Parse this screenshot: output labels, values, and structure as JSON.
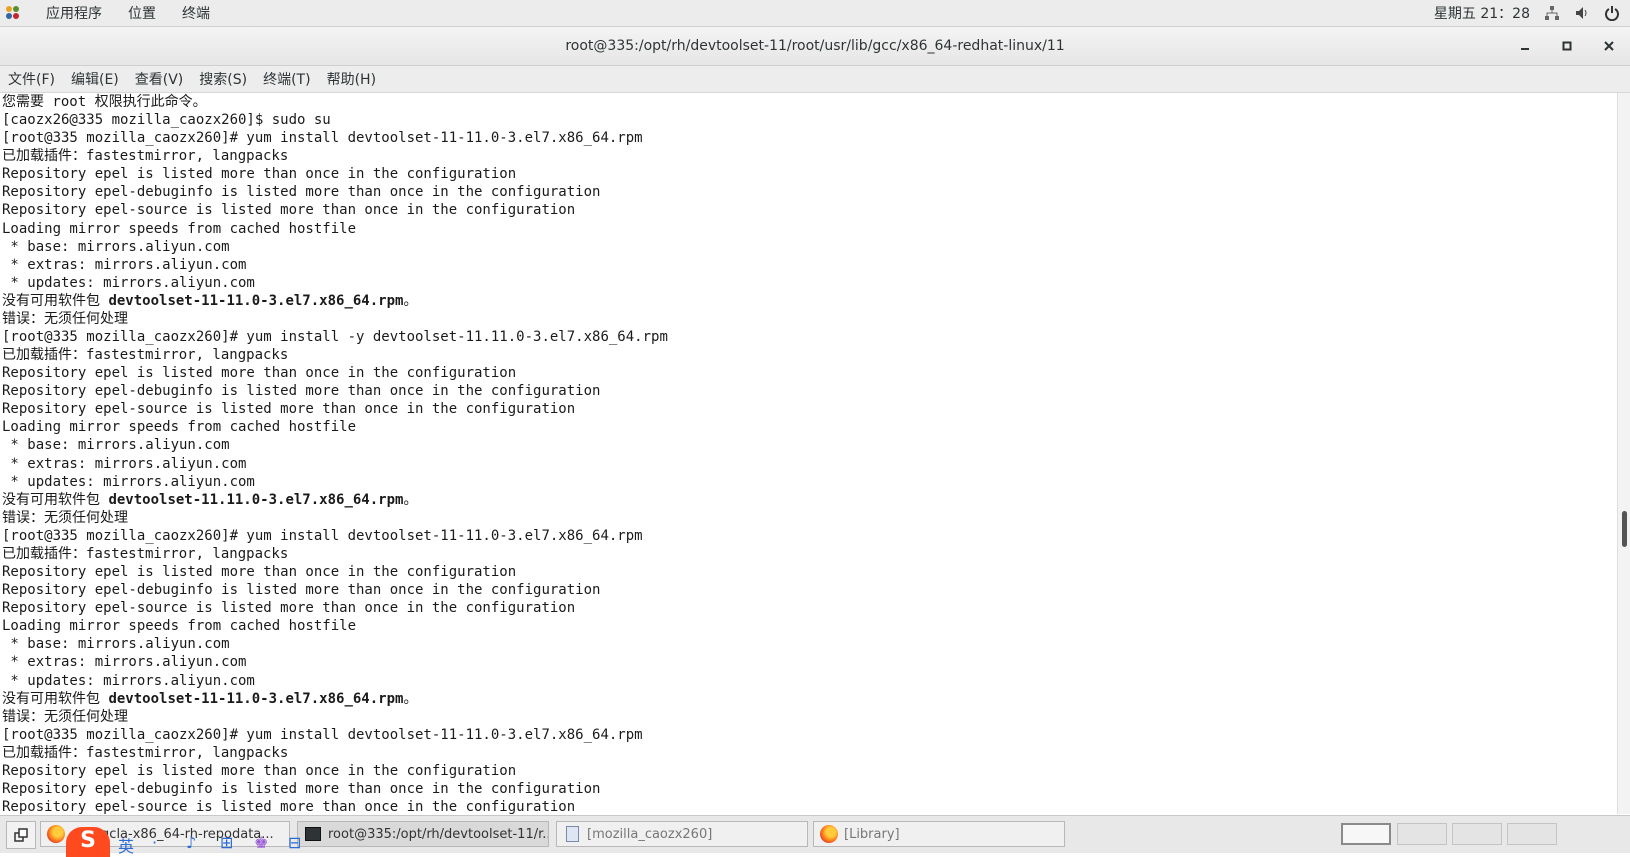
{
  "top_panel": {
    "menus": [
      "应用程序",
      "位置",
      "终端"
    ],
    "clock": "星期五 21：28",
    "icons": [
      "network-icon",
      "volume-icon",
      "power-icon"
    ]
  },
  "window": {
    "title": "root@335:/opt/rh/devtoolset-11/root/usr/lib/gcc/x86_64-redhat-linux/11",
    "controls": [
      "minimize-icon",
      "maximize-icon",
      "close-icon"
    ]
  },
  "menubar": {
    "items": [
      "文件(F)",
      "编辑(E)",
      "查看(V)",
      "搜索(S)",
      "终端(T)",
      "帮助(H)"
    ]
  },
  "terminal": {
    "lines": [
      {
        "text": "您需要 root 权限执行此命令。"
      },
      {
        "text": "[caozx26@335 mozilla_caozx260]$ sudo su"
      },
      {
        "text": "[root@335 mozilla_caozx260]# yum install devtoolset-11-11.0-3.el7.x86_64.rpm"
      },
      {
        "text": "已加载插件：fastestmirror, langpacks"
      },
      {
        "text": "Repository epel is listed more than once in the configuration"
      },
      {
        "text": "Repository epel-debuginfo is listed more than once in the configuration"
      },
      {
        "text": "Repository epel-source is listed more than once in the configuration"
      },
      {
        "text": "Loading mirror speeds from cached hostfile"
      },
      {
        "text": " * base: mirrors.aliyun.com"
      },
      {
        "text": " * extras: mirrors.aliyun.com"
      },
      {
        "text": " * updates: mirrors.aliyun.com"
      },
      {
        "prefix": "没有可用软件包 ",
        "bold": "devtoolset-11-11.0-3.el7.x86_64.rpm",
        "suffix": "。"
      },
      {
        "text": "错误：无须任何处理"
      },
      {
        "text": "[root@335 mozilla_caozx260]# yum install -y devtoolset-11.11.0-3.el7.x86_64.rpm"
      },
      {
        "text": "已加载插件：fastestmirror, langpacks"
      },
      {
        "text": "Repository epel is listed more than once in the configuration"
      },
      {
        "text": "Repository epel-debuginfo is listed more than once in the configuration"
      },
      {
        "text": "Repository epel-source is listed more than once in the configuration"
      },
      {
        "text": "Loading mirror speeds from cached hostfile"
      },
      {
        "text": " * base: mirrors.aliyun.com"
      },
      {
        "text": " * extras: mirrors.aliyun.com"
      },
      {
        "text": " * updates: mirrors.aliyun.com"
      },
      {
        "prefix": "没有可用软件包 ",
        "bold": "devtoolset-11.11.0-3.el7.x86_64.rpm",
        "suffix": "。"
      },
      {
        "text": "错误：无须任何处理"
      },
      {
        "text": "[root@335 mozilla_caozx260]# yum install devtoolset-11-11.0-3.el7.x86_64.rpm"
      },
      {
        "text": "已加载插件：fastestmirror, langpacks"
      },
      {
        "text": "Repository epel is listed more than once in the configuration"
      },
      {
        "text": "Repository epel-debuginfo is listed more than once in the configuration"
      },
      {
        "text": "Repository epel-source is listed more than once in the configuration"
      },
      {
        "text": "Loading mirror speeds from cached hostfile"
      },
      {
        "text": " * base: mirrors.aliyun.com"
      },
      {
        "text": " * extras: mirrors.aliyun.com"
      },
      {
        "text": " * updates: mirrors.aliyun.com"
      },
      {
        "prefix": "没有可用软件包 ",
        "bold": "devtoolset-11-11.0-3.el7.x86_64.rpm",
        "suffix": "。"
      },
      {
        "text": "错误：无须任何处理"
      },
      {
        "text": "[root@335 mozilla_caozx260]# yum install devtoolset-11-11.0-3.el7.x86_64.rpm"
      },
      {
        "text": "已加载插件：fastestmirror, langpacks"
      },
      {
        "text": "Repository epel is listed more than once in the configuration"
      },
      {
        "text": "Repository epel-debuginfo is listed more than once in the configuration"
      },
      {
        "text": "Repository epel-source is listed more than once in the configuration"
      }
    ]
  },
  "taskbar": {
    "tasks": [
      {
        "label": "...-7-gcla-x86_64-rh-repodata...",
        "icon": "firefox-icon"
      },
      {
        "label": "root@335:/opt/rh/devtoolset-11/r...",
        "icon": "terminal-icon"
      },
      {
        "label": "[mozilla_caozx260]",
        "icon": "file-manager-icon"
      },
      {
        "label": "[Library]",
        "icon": "firefox-icon"
      }
    ],
    "ime": {
      "logo": "S",
      "items": [
        "英",
        "·",
        "♪",
        "⊞",
        "♚",
        "⊟"
      ]
    }
  }
}
